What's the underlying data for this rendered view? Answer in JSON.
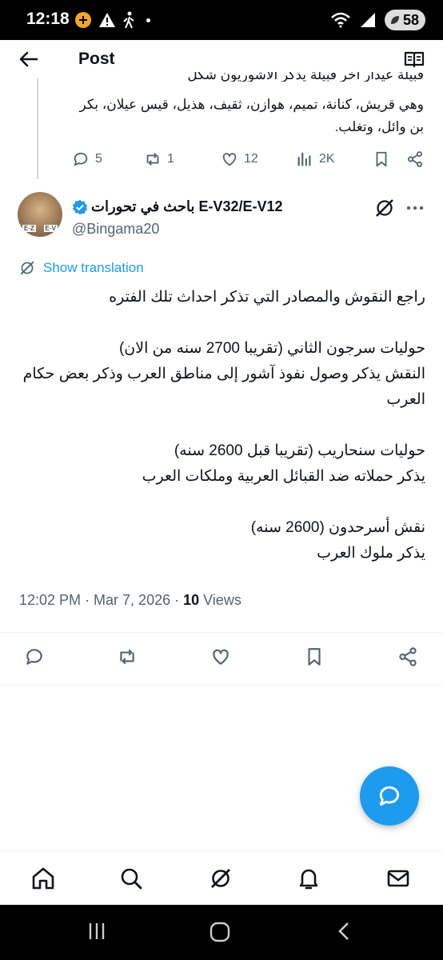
{
  "status_bar": {
    "time": "12:18",
    "battery": "58"
  },
  "header": {
    "title": "Post"
  },
  "previous_post": {
    "partial_line": "قبيلة عيدار اخر قبيلة يذكر الاشوريون شكل",
    "text_line1": "وهي قريش، كنانة، تميم، هوازن، ثقيف، هذيل، قيس عيلان، بكر",
    "text_line2": "بن وائل، وتغلب.",
    "replies": "5",
    "reposts": "1",
    "likes": "12",
    "views": "2K"
  },
  "post": {
    "author_name": "E-V32/E-V12 باحث في تحورات",
    "author_handle": "@Bingama20",
    "show_translation": "Show translation",
    "body": "راجع النقوش والمصادر التي تذكر احداث تلك الفتره\n\nحوليات سرجون الثاني (تقريبا 2700 سنه من الان)\nالنقش يذكر وصول نفوذ آشور إلى مناطق العرب وذكر بعض حكام العرب\n\nحوليات سنحاريب (تقريبا قبل 2600 سنه)\nيذكر حملاته ضد القبائل العربية وملكات العرب\n\nنقش أسرحدون (2600 سنه)\nيذكر ملوك العرب",
    "timestamp": "12:02 PM · Mar 7, 2026 · ",
    "views_count": "10",
    "views_label": " Views"
  },
  "colors": {
    "accent": "#1d9bf0",
    "text": "#0f1419",
    "secondary": "#536471"
  },
  "icons": [
    "back-arrow-icon",
    "reader-icon",
    "reply-icon",
    "repost-icon",
    "like-icon",
    "views-icon",
    "bookmark-icon",
    "share-icon",
    "verified-icon",
    "grok-icon",
    "more-icon",
    "compose-icon",
    "home-icon",
    "search-icon",
    "notifications-icon",
    "messages-icon"
  ]
}
